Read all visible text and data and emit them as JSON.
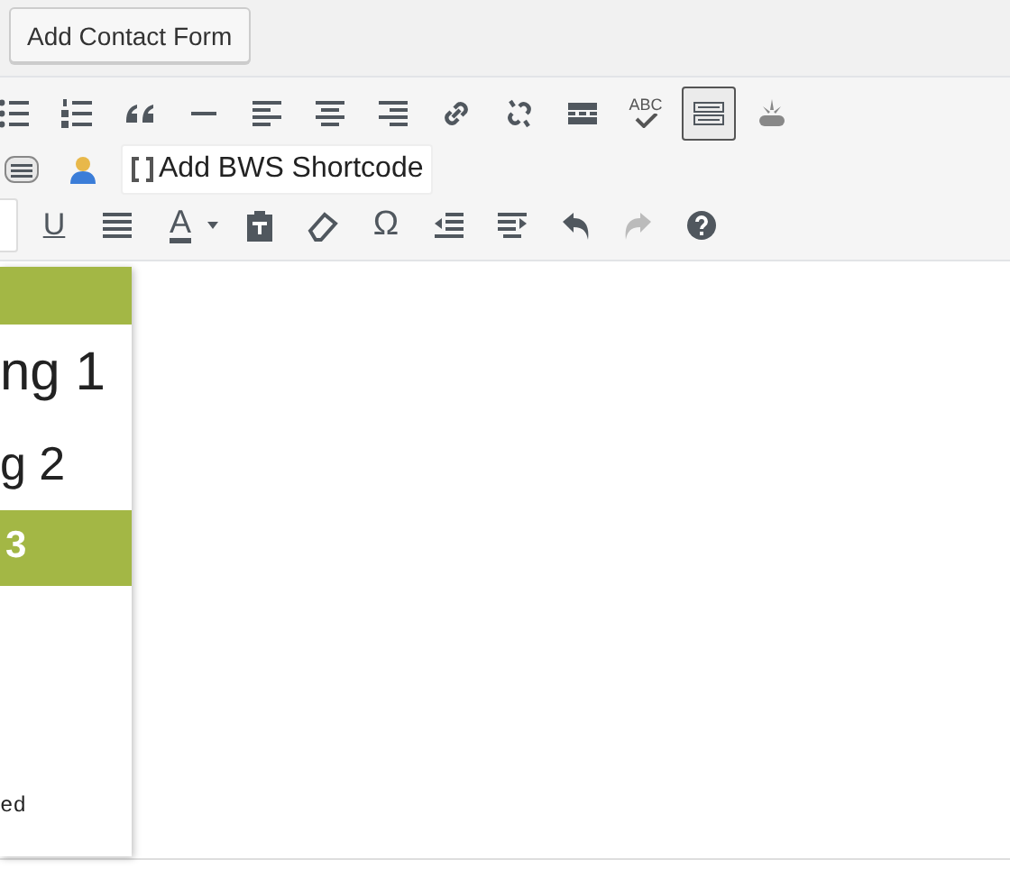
{
  "top_button": {
    "label": "Add Contact Form"
  },
  "toolbar_rows": [
    {
      "items": [
        {
          "kind": "bullet-list"
        },
        {
          "kind": "numbered-list"
        },
        {
          "kind": "blockquote"
        },
        {
          "kind": "hr"
        },
        {
          "kind": "align-left"
        },
        {
          "kind": "align-center"
        },
        {
          "kind": "align-right"
        },
        {
          "kind": "link"
        },
        {
          "kind": "unlink"
        },
        {
          "kind": "more"
        },
        {
          "kind": "spellcheck",
          "glyph": "ABC"
        },
        {
          "kind": "keyboard",
          "pressed": true
        },
        {
          "kind": "plugin"
        }
      ]
    },
    {
      "items": [
        {
          "kind": "lines-box"
        },
        {
          "kind": "user"
        },
        {
          "kind": "shortcode",
          "label": "Add BWS Shortcode"
        }
      ]
    },
    {
      "items": [
        {
          "kind": "cut",
          "pressed": true
        },
        {
          "kind": "underline",
          "glyph": "U"
        },
        {
          "kind": "justify"
        },
        {
          "kind": "text-color",
          "glyph": "A"
        },
        {
          "kind": "caret"
        },
        {
          "kind": "paste-text"
        },
        {
          "kind": "eraser"
        },
        {
          "kind": "special-char",
          "glyph": "Ω"
        },
        {
          "kind": "outdent"
        },
        {
          "kind": "indent"
        },
        {
          "kind": "undo"
        },
        {
          "kind": "redo",
          "disabled": true
        },
        {
          "kind": "help"
        }
      ]
    }
  ],
  "format_menu": {
    "items": [
      {
        "kind": "p",
        "selected": true
      },
      {
        "kind": "h1",
        "label": "ng 1",
        "selected": false
      },
      {
        "kind": "h2",
        "label": "g 2",
        "selected": false
      },
      {
        "kind": "h3",
        "label": "3",
        "selected": true
      },
      {
        "kind": "pre",
        "label": "ed",
        "selected": false
      }
    ]
  }
}
